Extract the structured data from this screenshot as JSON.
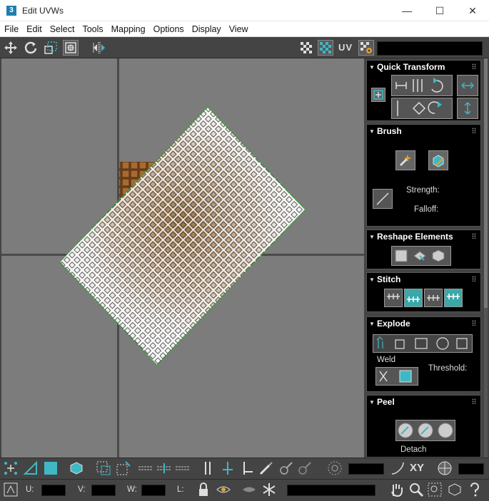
{
  "window": {
    "title": "Edit UVWs",
    "app_icon_glyph": "3",
    "controls": {
      "minimize": "—",
      "maximize": "☐",
      "close": "✕"
    }
  },
  "menu": {
    "items": [
      "File",
      "Edit",
      "Select",
      "Tools",
      "Mapping",
      "Options",
      "Display",
      "View"
    ]
  },
  "toolbar": {
    "uv_label": "UV",
    "icons": [
      "move-icon",
      "rotate-icon",
      "scale-icon",
      "freeform-icon",
      "mirror-icon",
      "checker-display-icon",
      "checker-pattern-icon",
      "settings-icon"
    ]
  },
  "viewport": {
    "background_color": "#7c7c7c",
    "grid_line_color": "#4a4a4a",
    "texture_tile_color": "#7a4a20",
    "uv_shell_border_color": "#3f9a3f",
    "uv_shell_fill": "#ffffff"
  },
  "panels": {
    "quick_transform": {
      "title": "Quick Transform"
    },
    "brush": {
      "title": "Brush",
      "strength_label": "Strength:",
      "falloff_label": "Falloff:"
    },
    "reshape": {
      "title": "Reshape Elements"
    },
    "stitch": {
      "title": "Stitch"
    },
    "explode": {
      "title": "Explode",
      "weld_label": "Weld",
      "threshold_label": "Threshold:"
    },
    "peel": {
      "title": "Peel",
      "detach_label": "Detach"
    }
  },
  "bottom_bar": {
    "xy_label": "XY",
    "u_label": "U:",
    "v_label": "V:",
    "w_label": "W:",
    "l_label": "L:"
  },
  "colors": {
    "accent_teal": "#3fb8c4",
    "panel_bg": "#000000",
    "ui_bg": "#444444"
  }
}
